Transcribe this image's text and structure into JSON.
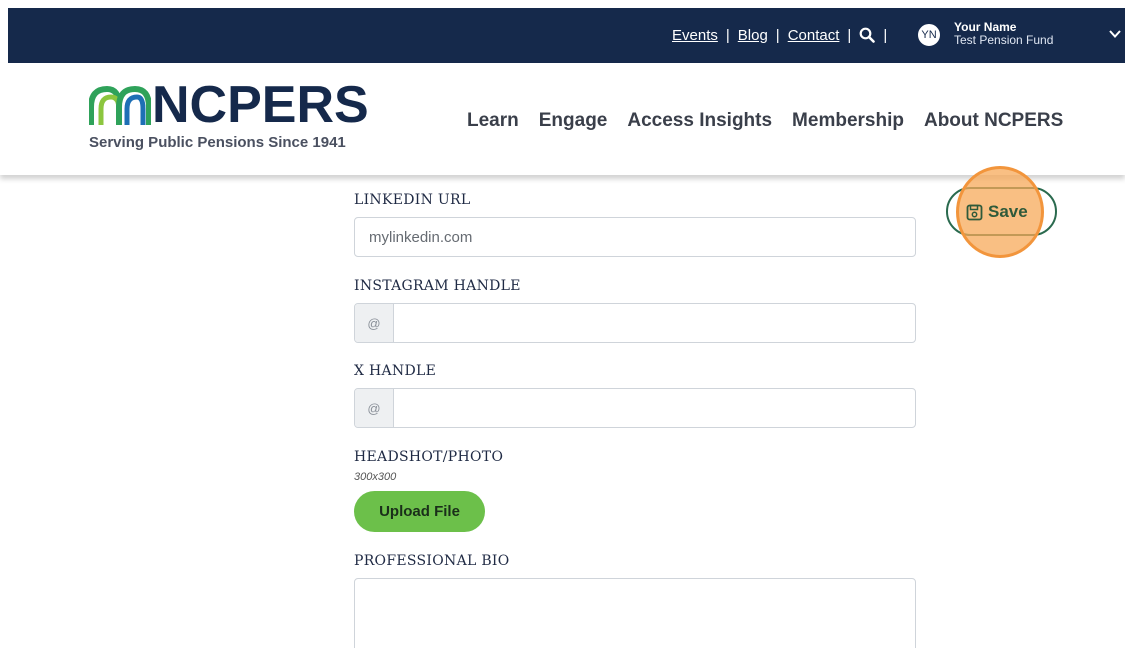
{
  "topbar": {
    "links": [
      "Events",
      "Blog",
      "Contact"
    ],
    "separator": "|",
    "avatar_initials": "YN",
    "user_name": "Your Name",
    "user_org": "Test Pension Fund"
  },
  "header": {
    "logo_text": "NCPERS",
    "tagline": "Serving Public Pensions Since 1941",
    "nav": [
      "Learn",
      "Engage",
      "Access Insights",
      "Membership",
      "About NCPERS"
    ]
  },
  "form": {
    "linkedin_label": "LINKEDIN URL",
    "linkedin_value": "mylinkedin.com",
    "instagram_label": "INSTAGRAM HANDLE",
    "instagram_prefix": "@",
    "x_label": "X HANDLE",
    "x_prefix": "@",
    "headshot_label": "HEADSHOT/PHOTO",
    "headshot_hint": "300x300",
    "upload_label": "Upload File",
    "bio_label": "PROFESSIONAL BIO"
  },
  "actions": {
    "save_label": "Save"
  },
  "colors": {
    "topbar_bg": "#15294b",
    "upload_green": "#6cc04a",
    "save_outline": "#2a6a4e",
    "highlight_orange": "#f2953c"
  }
}
